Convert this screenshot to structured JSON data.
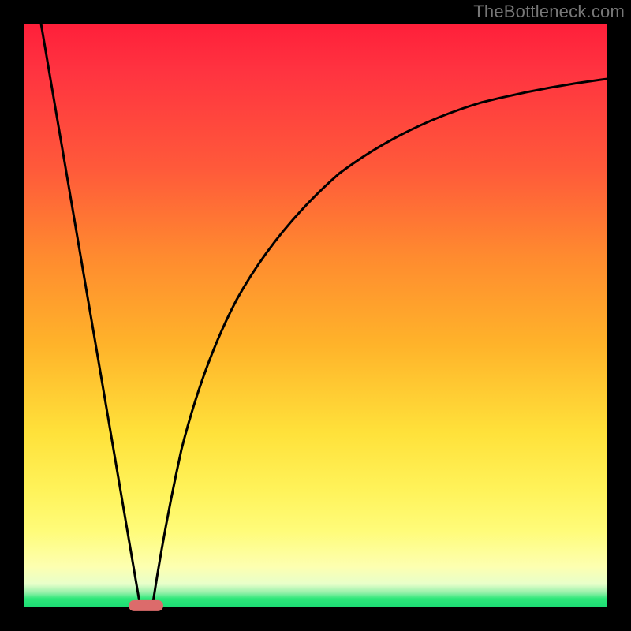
{
  "watermark": "TheBottleneck.com",
  "chart_data": {
    "type": "line",
    "title": "",
    "xlabel": "",
    "ylabel": "",
    "xlim": [
      0,
      100
    ],
    "ylim": [
      0,
      100
    ],
    "background_gradient": {
      "orientation": "vertical",
      "stops": [
        {
          "pos": 0,
          "color": "#ff1f3a"
        },
        {
          "pos": 25,
          "color": "#ff5a3a"
        },
        {
          "pos": 55,
          "color": "#ffb32a"
        },
        {
          "pos": 80,
          "color": "#fff35a"
        },
        {
          "pos": 96,
          "color": "#e8ffca"
        },
        {
          "pos": 100,
          "color": "#1bdc74"
        }
      ]
    },
    "series": [
      {
        "name": "left-descent",
        "segment": "line",
        "x": [
          3,
          20
        ],
        "y": [
          100,
          0
        ]
      },
      {
        "name": "right-ascent",
        "segment": "curve",
        "x": [
          22,
          25,
          30,
          35,
          40,
          50,
          60,
          70,
          80,
          90,
          100
        ],
        "y": [
          0,
          18,
          38,
          52,
          62,
          74,
          81,
          85.5,
          88,
          89.5,
          90.5
        ]
      }
    ],
    "bottom_marker": {
      "x": 21,
      "color": "#dc6b6b"
    }
  }
}
